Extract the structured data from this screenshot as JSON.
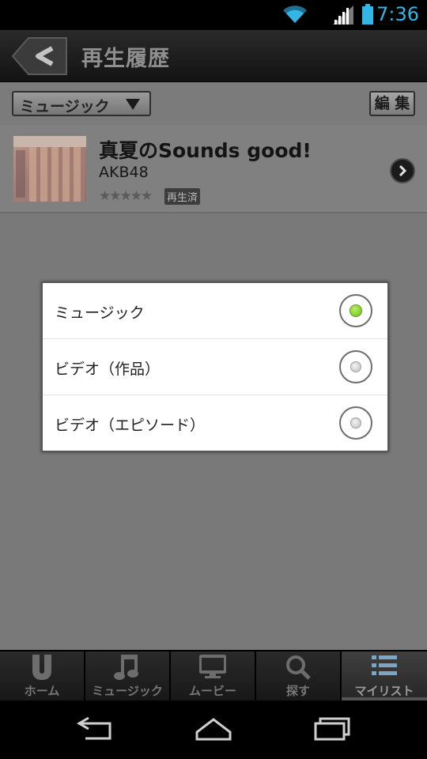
{
  "status_bar": {
    "time": "7:36",
    "icons": [
      "wifi-icon",
      "signal-icon",
      "battery-icon"
    ],
    "accent_color": "#33b5e5"
  },
  "action_bar": {
    "back_icon": "back-arrow-icon",
    "title": "再生履歴"
  },
  "filter_bar": {
    "dropdown_value": "ミュージック",
    "edit_label": "編 集"
  },
  "list": {
    "items": [
      {
        "title": "真夏のSounds good!",
        "artist": "AKB48",
        "rating_stars": 0,
        "rating_max": 5,
        "badge": "再生済"
      }
    ]
  },
  "dialog": {
    "options": [
      {
        "label": "ミュージック",
        "selected": true
      },
      {
        "label": "ビデオ（作品）",
        "selected": false
      },
      {
        "label": "ビデオ（エピソード）",
        "selected": false
      }
    ],
    "selected_color": "#7ed321"
  },
  "tabs": [
    {
      "label": "ホーム",
      "icon": "u-logo-icon"
    },
    {
      "label": "ミュージック",
      "icon": "music-note-icon"
    },
    {
      "label": "ムービー",
      "icon": "tv-icon"
    },
    {
      "label": "探す",
      "icon": "search-icon"
    },
    {
      "label": "マイリスト",
      "icon": "list-icon",
      "active": true
    }
  ],
  "nav_bar": {
    "buttons": [
      "back-icon",
      "home-icon",
      "recent-apps-icon"
    ]
  }
}
